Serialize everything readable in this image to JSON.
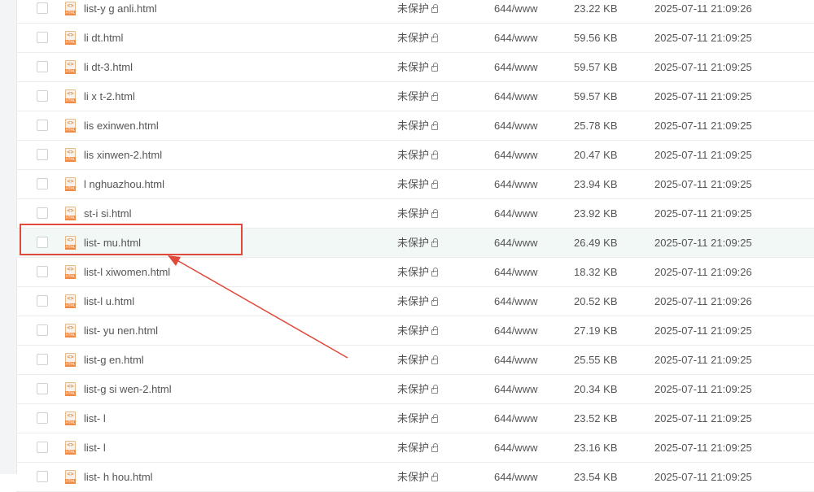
{
  "rows": [
    {
      "name": "list-y   g      anli.html",
      "perm": "未保护",
      "owner": "644/www",
      "size": "23.22 KB",
      "mtime": "2025-07-11 21:09:26"
    },
    {
      "name": "li     dt.html",
      "perm": "未保护",
      "owner": "644/www",
      "size": "59.56 KB",
      "mtime": "2025-07-11 21:09:25"
    },
    {
      "name": "li      dt-3.html",
      "perm": "未保护",
      "owner": "644/www",
      "size": "59.57 KB",
      "mtime": "2025-07-11 21:09:25"
    },
    {
      "name": "li    x   t-2.html",
      "perm": "未保护",
      "owner": "644/www",
      "size": "59.57 KB",
      "mtime": "2025-07-11 21:09:25"
    },
    {
      "name": "lis         exinwen.html",
      "perm": "未保护",
      "owner": "644/www",
      "size": "25.78 KB",
      "mtime": "2025-07-11 21:09:25"
    },
    {
      "name": "lis         xinwen-2.html",
      "perm": "未保护",
      "owner": "644/www",
      "size": "20.47 KB",
      "mtime": "2025-07-11 21:09:25"
    },
    {
      "name": "l        nghuazhou.html",
      "perm": "未保护",
      "owner": "644/www",
      "size": "23.94 KB",
      "mtime": "2025-07-11 21:09:25"
    },
    {
      "name": "    st-i    si.html",
      "perm": "未保护",
      "owner": "644/www",
      "size": "23.92 KB",
      "mtime": "2025-07-11 21:09:25"
    },
    {
      "name": "list-    mu.html",
      "perm": "未保护",
      "owner": "644/www",
      "size": "26.49 KB",
      "mtime": "2025-07-11 21:09:25"
    },
    {
      "name": "list-l    xiwomen.html",
      "perm": "未保护",
      "owner": "644/www",
      "size": "18.32 KB",
      "mtime": "2025-07-11 21:09:26"
    },
    {
      "name": "list-l          u.html",
      "perm": "未保护",
      "owner": "644/www",
      "size": "20.52 KB",
      "mtime": "2025-07-11 21:09:26"
    },
    {
      "name": "list-      yu      nen.html",
      "perm": "未保护",
      "owner": "644/www",
      "size": "27.19 KB",
      "mtime": "2025-07-11 21:09:25"
    },
    {
      "name": "list-g            en.html",
      "perm": "未保护",
      "owner": "644/www",
      "size": "25.55 KB",
      "mtime": "2025-07-11 21:09:25"
    },
    {
      "name": "list-g      si     wen-2.html",
      "perm": "未保护",
      "owner": "644/www",
      "size": "20.34 KB",
      "mtime": "2025-07-11 21:09:25"
    },
    {
      "name": "list-          l",
      "perm": "未保护",
      "owner": "644/www",
      "size": "23.52 KB",
      "mtime": "2025-07-11 21:09:25"
    },
    {
      "name": "list-          l",
      "perm": "未保护",
      "owner": "644/www",
      "size": "23.16 KB",
      "mtime": "2025-07-11 21:09:25"
    },
    {
      "name": "list-     h     hou.html",
      "perm": "未保护",
      "owner": "644/www",
      "size": "23.54 KB",
      "mtime": "2025-07-11 21:09:25"
    }
  ],
  "icon": {
    "code": "<>",
    "tag": "HTML",
    "color": "#ee8a43"
  },
  "highlight_index": 8,
  "annotation_color": "#e04a3a"
}
